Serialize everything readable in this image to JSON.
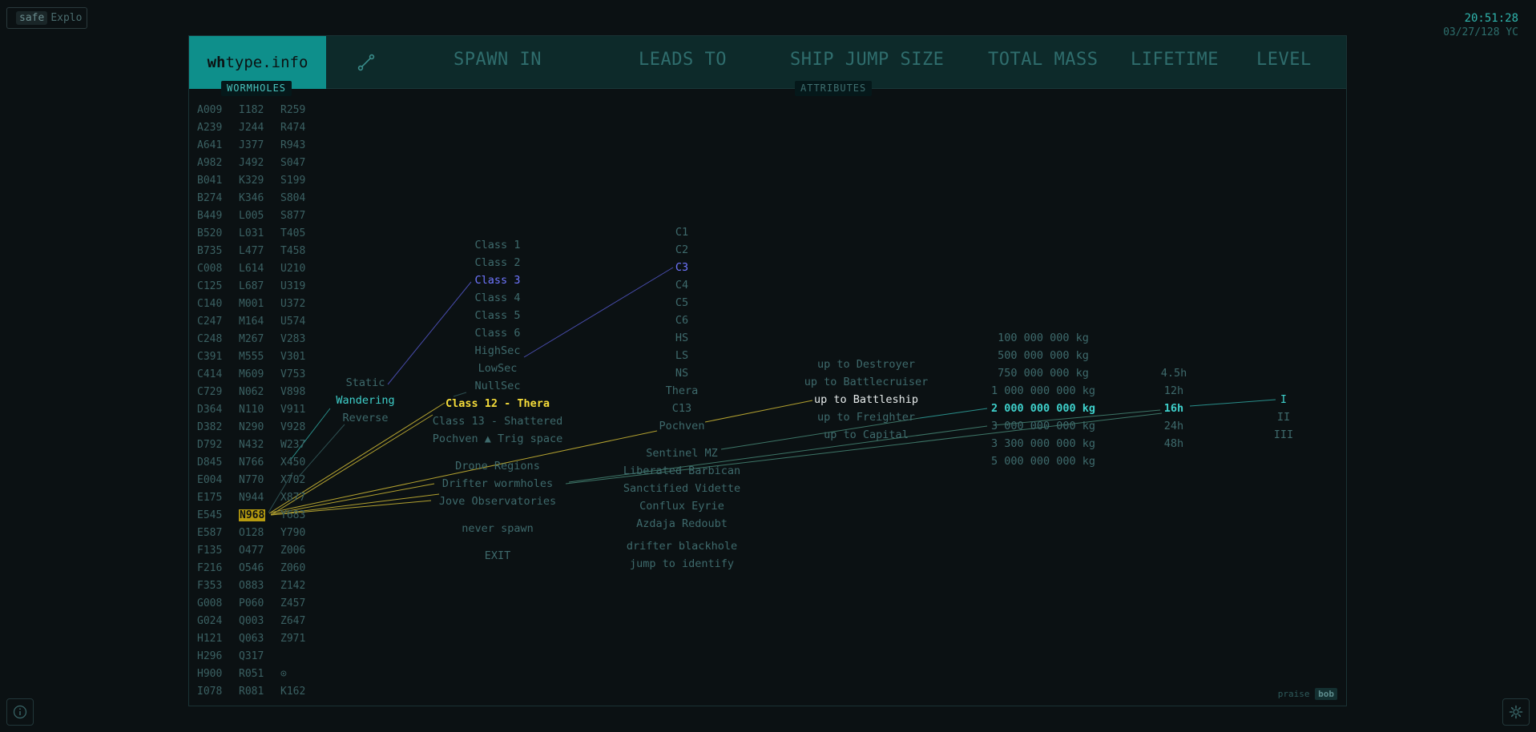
{
  "badge": {
    "key": "safe",
    "label": "Explo"
  },
  "clock": {
    "time": "20:51:28",
    "date": "03/27/128 YC"
  },
  "logo": {
    "bold": "wh",
    "rest": "type.info"
  },
  "headers": {
    "spawn_in": "SPAWN IN",
    "leads_to": "LEADS TO",
    "jump_size": "SHIP JUMP SIZE",
    "total_mass": "TOTAL MASS",
    "lifetime": "LIFETIME",
    "level": "LEVEL"
  },
  "tags": {
    "wormholes": "WORMHOLES",
    "attributes": "ATTRIBUTES"
  },
  "wormholes": {
    "col1": [
      "A009",
      "A239",
      "A641",
      "A982",
      "B041",
      "B274",
      "B449",
      "B520",
      "B735",
      "C008",
      "C125",
      "C140",
      "C247",
      "C248",
      "C391",
      "C414",
      "C729",
      "D364",
      "D382",
      "D792",
      "D845",
      "E004",
      "E175",
      "E545",
      "E587",
      "F135",
      "F216",
      "F353",
      "G008",
      "G024",
      "H121",
      "H296",
      "H900",
      "I078"
    ],
    "col2": [
      "I182",
      "J244",
      "J377",
      "J492",
      "K329",
      "K346",
      "L005",
      "L031",
      "L477",
      "L614",
      "L687",
      "M001",
      "M164",
      "M267",
      "M555",
      "M609",
      "N062",
      "N110",
      "N290",
      "N432",
      "N766",
      "N770",
      "N944",
      "N968",
      "O128",
      "O477",
      "O546",
      "O883",
      "P060",
      "Q003",
      "Q063",
      "Q317",
      "R051",
      "R081"
    ],
    "col3": [
      "R259",
      "R474",
      "R943",
      "S047",
      "S199",
      "S804",
      "S877",
      "T405",
      "T458",
      "U210",
      "U319",
      "U372",
      "U574",
      "V283",
      "V301",
      "V753",
      "V898",
      "V911",
      "V928",
      "W237",
      "X450",
      "X702",
      "X877",
      "Y683",
      "Y790",
      "Z006",
      "Z060",
      "Z142",
      "Z457",
      "Z647",
      "Z971",
      "",
      "⊙",
      "K162"
    ],
    "selected": "N968"
  },
  "spawn_type": {
    "items": [
      "Static",
      "Wandering",
      "Reverse"
    ],
    "selected": "Wandering"
  },
  "spawn_in": {
    "items": [
      "Class 1",
      "Class 2",
      "Class 3",
      "Class 4",
      "Class 5",
      "Class 6",
      "HighSec",
      "LowSec",
      "NullSec",
      "Class 12 - Thera",
      "Class 13 - Shattered",
      "Pochven ▲ Trig space"
    ],
    "extra": [
      "Drone Regions",
      "Drifter wormholes",
      "Jove Observatories"
    ],
    "never": "never spawn",
    "exit": "EXIT",
    "selected_class": "Class 3",
    "selected_special": "Class 12 - Thera"
  },
  "leads_to": {
    "items": [
      "C1",
      "C2",
      "C3",
      "C4",
      "C5",
      "C6",
      "HS",
      "LS",
      "NS",
      "Thera",
      "C13",
      "Pochven"
    ],
    "extra": [
      "Sentinel MZ",
      "Liberated Barbican",
      "Sanctified Vidette",
      "Conflux Eyrie",
      "Azdaja Redoubt"
    ],
    "note1": "drifter blackhole",
    "note2": "jump to identify",
    "selected": "C3"
  },
  "jump_size": {
    "items": [
      "up to Destroyer",
      "up to Battlecruiser",
      "up to Battleship",
      "up to Freighter",
      "up to Capital"
    ],
    "selected": "up to Battleship"
  },
  "total_mass": {
    "items": [
      "100 000 000 kg",
      "500 000 000 kg",
      "750 000 000 kg",
      "1 000 000 000 kg",
      "2 000 000 000 kg",
      "3 000 000 000 kg",
      "3 300 000 000 kg",
      "5 000 000 000 kg"
    ],
    "selected": "2 000 000 000 kg"
  },
  "lifetime": {
    "items": [
      "4.5h",
      "12h",
      "16h",
      "24h",
      "48h"
    ],
    "selected": "16h"
  },
  "level": {
    "items": [
      "I",
      "II",
      "III"
    ],
    "selected": "I"
  },
  "footer": {
    "prefix": "praise",
    "key": "bob"
  },
  "colors": {
    "accent": "#0e8f8b",
    "cyan": "#3ed0cb",
    "blue": "#6f76ff",
    "yellow": "#f5dc3a"
  }
}
